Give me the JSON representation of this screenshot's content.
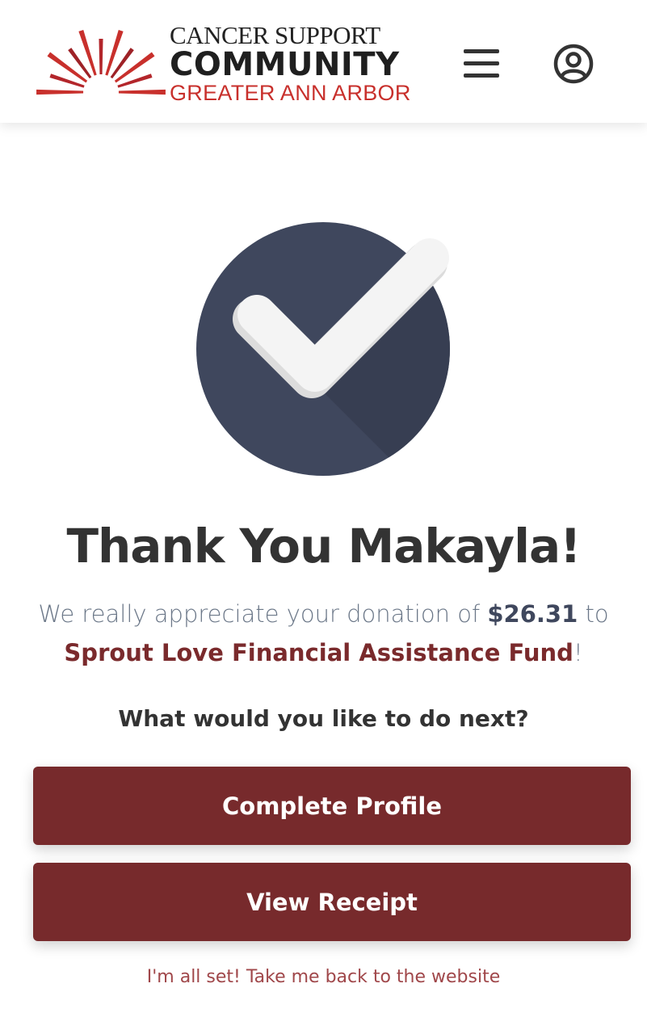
{
  "header": {
    "logo": {
      "line1": "CANCER SUPPORT",
      "line2": "COMMUNITY",
      "line3": "GREATER ANN ARBOR",
      "icon": "sunburst-logo-icon"
    },
    "menu_icon": "hamburger-menu-icon",
    "account_icon": "user-account-icon"
  },
  "confirmation": {
    "icon": "checkmark-circle-icon",
    "title": "Thank You Makayla!",
    "message_prefix": "We really appreciate your donation of ",
    "amount": "$26.31",
    "message_mid": " to",
    "fund_name": "Sprout Love Financial Assistance Fund",
    "message_suffix": "!",
    "next_prompt": "What would you like to do next?"
  },
  "actions": {
    "complete_profile_label": "Complete Profile",
    "view_receipt_label": "View Receipt",
    "back_link_label": "I'm all set! Take me back to the website"
  },
  "colors": {
    "brand_red": "#c8302c",
    "button_maroon": "#772a2c",
    "check_circle": "#3f475d",
    "text_dark": "#333333",
    "text_muted": "#6b7788"
  }
}
